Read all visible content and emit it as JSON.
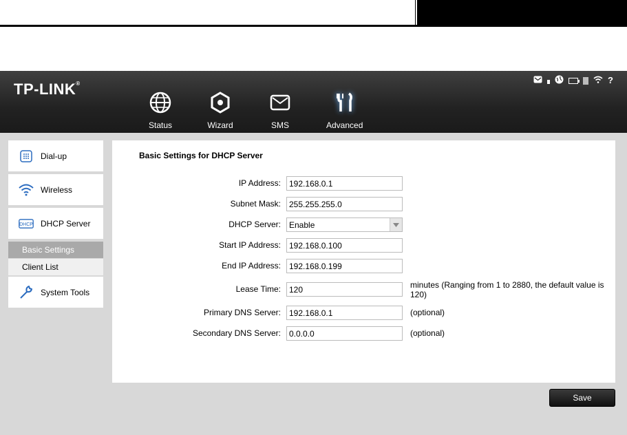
{
  "brand": {
    "name": "TP-LINK"
  },
  "nav": [
    {
      "label": "Status",
      "icon": "globe-icon"
    },
    {
      "label": "Wizard",
      "icon": "wizard-icon"
    },
    {
      "label": "SMS",
      "icon": "envelope-icon"
    },
    {
      "label": "Advanced",
      "icon": "tools-icon"
    }
  ],
  "status_icons": [
    "sms-icon",
    "signal-icon",
    "internet-icon",
    "battery-icon",
    "sd-card-icon",
    "wifi-icon",
    "help-icon"
  ],
  "sidebar": {
    "items": [
      {
        "label": "Dial-up",
        "icon": "dialup-icon"
      },
      {
        "label": "Wireless",
        "icon": "wifi-icon"
      },
      {
        "label": "DHCP Server",
        "icon": "dhcp-icon"
      },
      {
        "label": "System Tools",
        "icon": "wrench-icon"
      }
    ],
    "submenu": [
      {
        "label": "Basic Settings",
        "active": true
      },
      {
        "label": "Client List",
        "active": false
      }
    ]
  },
  "form": {
    "title": "Basic Settings for DHCP Server",
    "fields": {
      "ip_address": {
        "label": "IP Address:",
        "value": "192.168.0.1"
      },
      "subnet_mask": {
        "label": "Subnet Mask:",
        "value": "255.255.255.0"
      },
      "dhcp_server": {
        "label": "DHCP Server:",
        "value": "Enable"
      },
      "start_ip": {
        "label": "Start IP Address:",
        "value": "192.168.0.100"
      },
      "end_ip": {
        "label": "End IP Address:",
        "value": "192.168.0.199"
      },
      "lease_time": {
        "label": "Lease Time:",
        "value": "120",
        "note": "minutes (Ranging from 1 to 2880, the default value is 120)"
      },
      "primary_dns": {
        "label": "Primary DNS Server:",
        "value": "192.168.0.1",
        "note": "(optional)"
      },
      "secondary_dns": {
        "label": "Secondary DNS Server:",
        "value": "0.0.0.0",
        "note": "(optional)"
      }
    },
    "save_label": "Save"
  },
  "colors": {
    "topbar": "#222222",
    "active_sub": "#a9a9a9",
    "background": "#d8d8d8"
  }
}
